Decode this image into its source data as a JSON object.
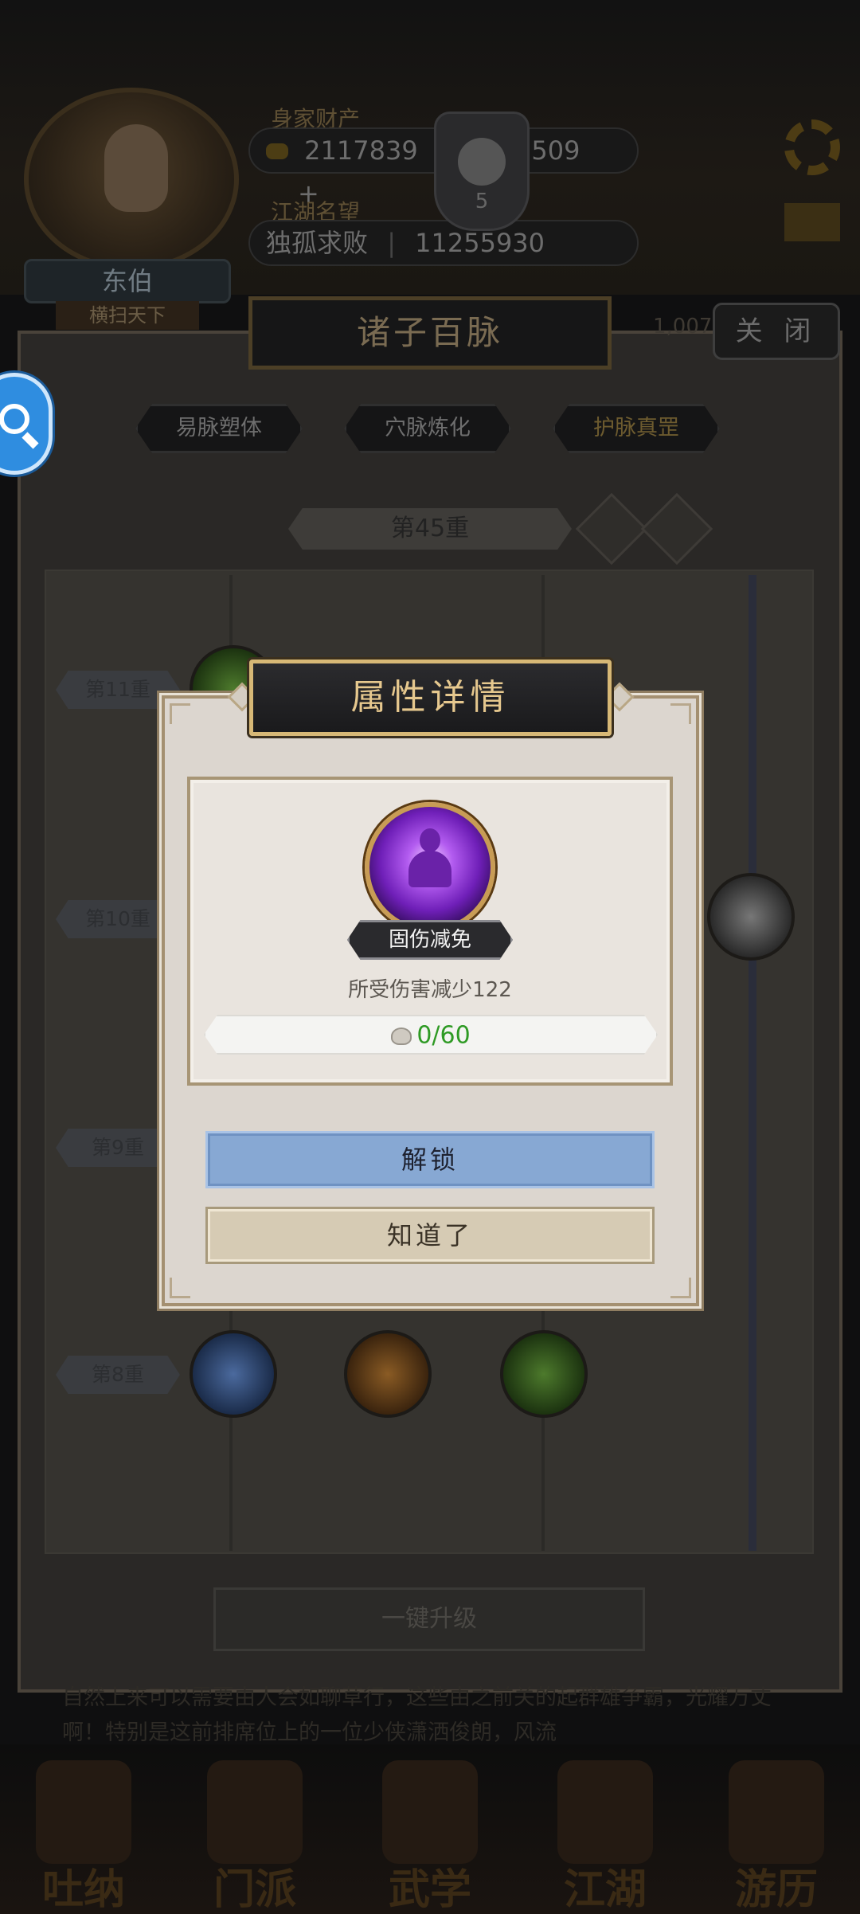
{
  "header": {
    "wealth_label": "身家财产",
    "gold": "2117839",
    "gems": "3509",
    "plus": "+",
    "reputation_label": "江湖名望",
    "title": "独孤求败",
    "reputation": "11255930",
    "level": "5",
    "player_name": "东伯",
    "player_subtitle": "横扫天下"
  },
  "panel": {
    "title": "诸子百脉",
    "close_label": "关 闭",
    "ghost_number": "1,007",
    "tabs": [
      {
        "label": "易脉塑体"
      },
      {
        "label": "穴脉炼化"
      },
      {
        "label": "护脉真罡"
      }
    ],
    "level_selector": "第45重",
    "rows": [
      {
        "label": "第11重"
      },
      {
        "label": "第10重"
      },
      {
        "label": "第9重"
      },
      {
        "label": "第8重"
      }
    ],
    "upgrade_label": "一键升级",
    "story_text": "自然上来可以需要由人会如聊草行，这些由之前关的起群雄争霸，光耀万丈啊！特别是这前排席位上的一位少侠潇洒俊朗，风流"
  },
  "modal": {
    "title": "属性详情",
    "skill_name": "固伤减免",
    "description": "所受伤害减少122",
    "cost": "0/60",
    "unlock_label": "解锁",
    "ok_label": "知道了"
  },
  "bottom_nav": [
    {
      "label": "吐纳",
      "icon": "breathing-icon"
    },
    {
      "label": "门派",
      "icon": "sect-icon"
    },
    {
      "label": "武学",
      "icon": "martial-arts-icon"
    },
    {
      "label": "江湖",
      "icon": "jianghu-icon"
    },
    {
      "label": "游历",
      "icon": "travel-icon"
    }
  ],
  "colors": {
    "modal_title_text": "#e6c88e",
    "cost_text": "#2e9a24",
    "unlock_button": "#87a8d3",
    "ok_button": "#d6cbb4",
    "float_bubble": "#2f8de0"
  }
}
